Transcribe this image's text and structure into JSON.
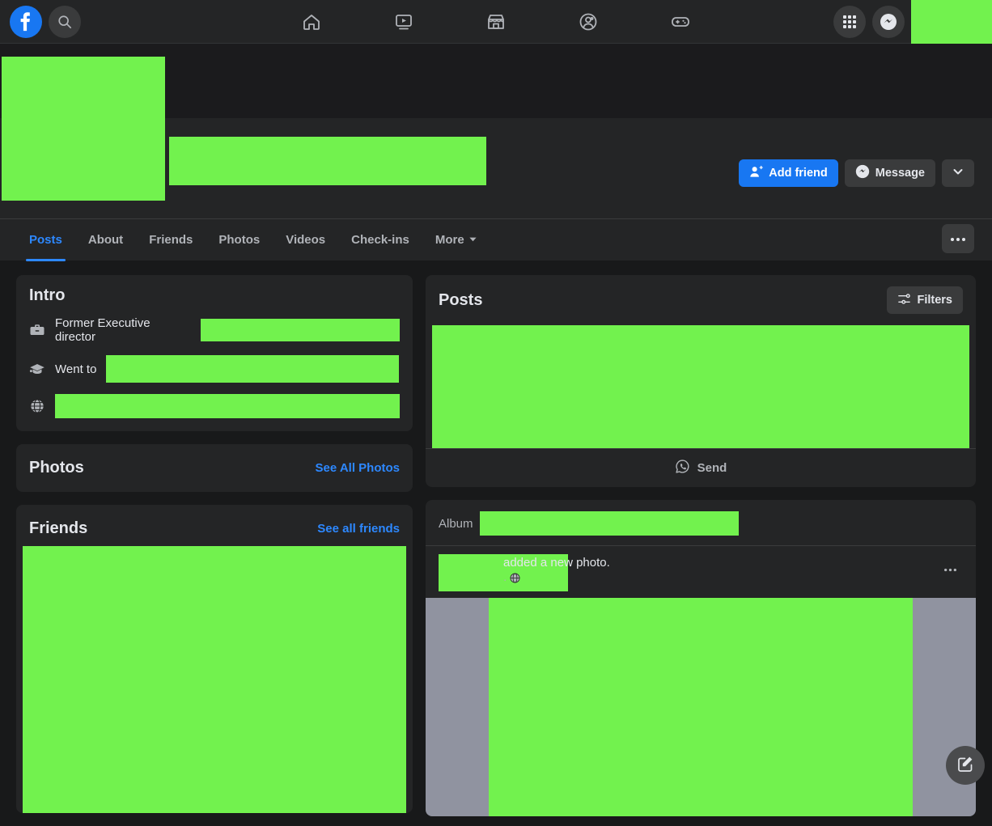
{
  "colors": {
    "brand_blue": "#1877f2",
    "link_blue": "#2d88ff",
    "card_bg": "#242526",
    "page_bg": "#18191a",
    "cover_bg": "#1b1b1d",
    "redaction_green": "#72f24e",
    "secondary_btn": "#3a3b3c"
  },
  "topnav": {
    "logo_icon": "facebook-logo-icon",
    "search_icon": "search-icon",
    "tabs": [
      {
        "name": "home",
        "icon": "home-icon"
      },
      {
        "name": "watch",
        "icon": "video-watch-icon"
      },
      {
        "name": "marketplace",
        "icon": "marketplace-storefront-icon"
      },
      {
        "name": "groups",
        "icon": "groups-people-icon"
      },
      {
        "name": "gaming",
        "icon": "gaming-controller-icon"
      }
    ],
    "menu_icon": "grid-menu-icon",
    "messenger_icon": "messenger-icon"
  },
  "profile": {
    "name_redacted": true,
    "actions": {
      "add_friend_label": "Add friend",
      "add_friend_icon": "add-person-icon",
      "message_label": "Message",
      "message_icon": "messenger-icon",
      "dropdown_icon": "chevron-down-icon"
    }
  },
  "profile_tabs": {
    "items": [
      {
        "label": "Posts",
        "active": true
      },
      {
        "label": "About",
        "active": false
      },
      {
        "label": "Friends",
        "active": false
      },
      {
        "label": "Photos",
        "active": false
      },
      {
        "label": "Videos",
        "active": false
      },
      {
        "label": "Check-ins",
        "active": false
      },
      {
        "label": "More",
        "active": false,
        "icon": "chevron-down-icon"
      }
    ],
    "more_options_icon": "ellipsis-horizontal-icon"
  },
  "intro": {
    "title": "Intro",
    "rows": [
      {
        "icon": "briefcase-icon",
        "text": "Former Executive director",
        "redacted": true
      },
      {
        "icon": "graduation-cap-icon",
        "text": "Went to",
        "redacted": true
      },
      {
        "icon": "globe-icon",
        "text": "",
        "redacted": true
      }
    ]
  },
  "photos": {
    "title": "Photos",
    "see_all_label": "See All Photos"
  },
  "friends": {
    "title": "Friends",
    "see_all_label": "See all friends"
  },
  "posts": {
    "title": "Posts",
    "filters_label": "Filters",
    "filters_icon": "sliders-filter-icon",
    "send_label": "Send",
    "send_icon": "whatsapp-send-icon",
    "album_label": "Album",
    "album_value_redacted": true,
    "post_action_text": "added a new photo.",
    "privacy_icon": "globe-public-icon",
    "post_more_icon": "ellipsis-horizontal-icon"
  },
  "compose": {
    "icon": "compose-edit-icon"
  }
}
